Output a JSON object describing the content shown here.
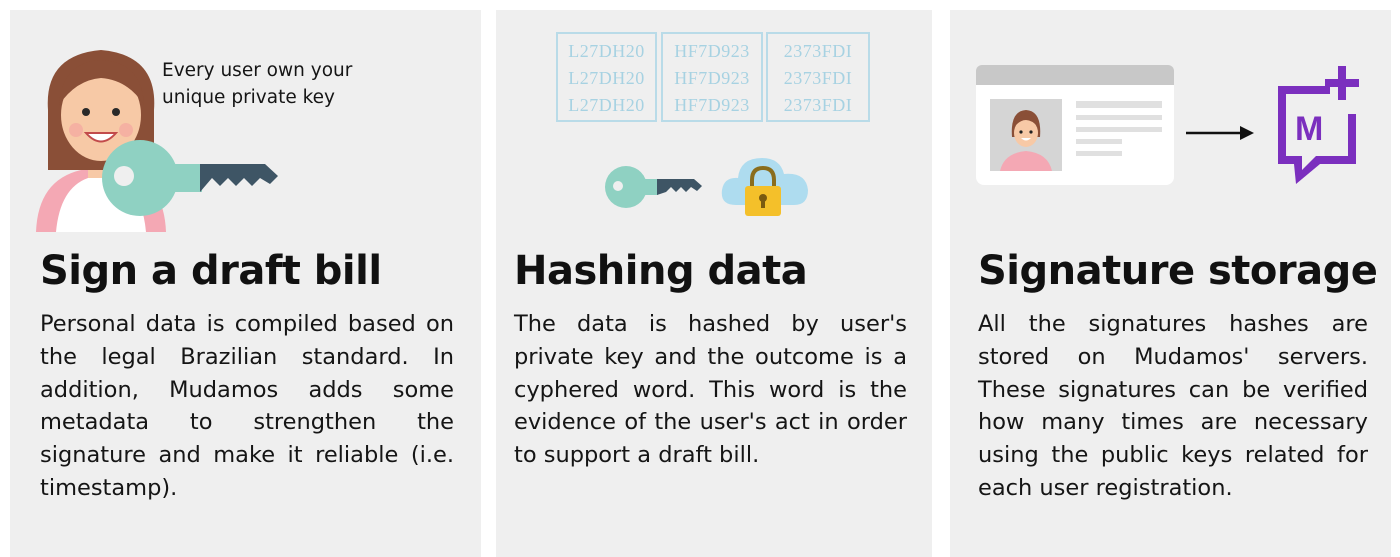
{
  "panels": [
    {
      "caption_line1": "Every user own your",
      "caption_line2": "unique private key",
      "title": "Sign a draft bill",
      "body": "Personal data is compiled based on the legal Brazilian standard. In addition, Mudamos adds some metadata to strengthen the signature and make it reliable (i.e. timestamp)."
    },
    {
      "hash_columns": [
        [
          "L27DH20",
          "L27DH20",
          "L27DH20"
        ],
        [
          "HF7D923",
          "HF7D923",
          "HF7D923"
        ],
        [
          "2373FDI",
          "2373FDI",
          "2373FDI"
        ]
      ],
      "title": "Hashing data",
      "body": "The data is hashed by user's private key and the outcome is a cyphered word. This word is the evidence of the user's act in order to support a draft bill."
    },
    {
      "logo_letter": "M",
      "title": "Signature storage",
      "body": "All the signatures hashes are stored on Mudamos' servers. These signatures can be verified how many times are necessary using the public keys related for each user registration."
    }
  ],
  "colors": {
    "panel_bg": "#efefef",
    "key_teal": "#8fd1c2",
    "key_dark": "#3e5565",
    "hash_blue": "#a7d2e2",
    "cloud_blue": "#aedcef",
    "lock_yellow": "#f4c02a",
    "logo_purple": "#7b2fbe"
  },
  "icons": [
    "user-avatar-icon",
    "key-icon",
    "cloud-lock-icon",
    "id-card-icon",
    "arrow-right-icon",
    "mudamos-logo-icon"
  ]
}
